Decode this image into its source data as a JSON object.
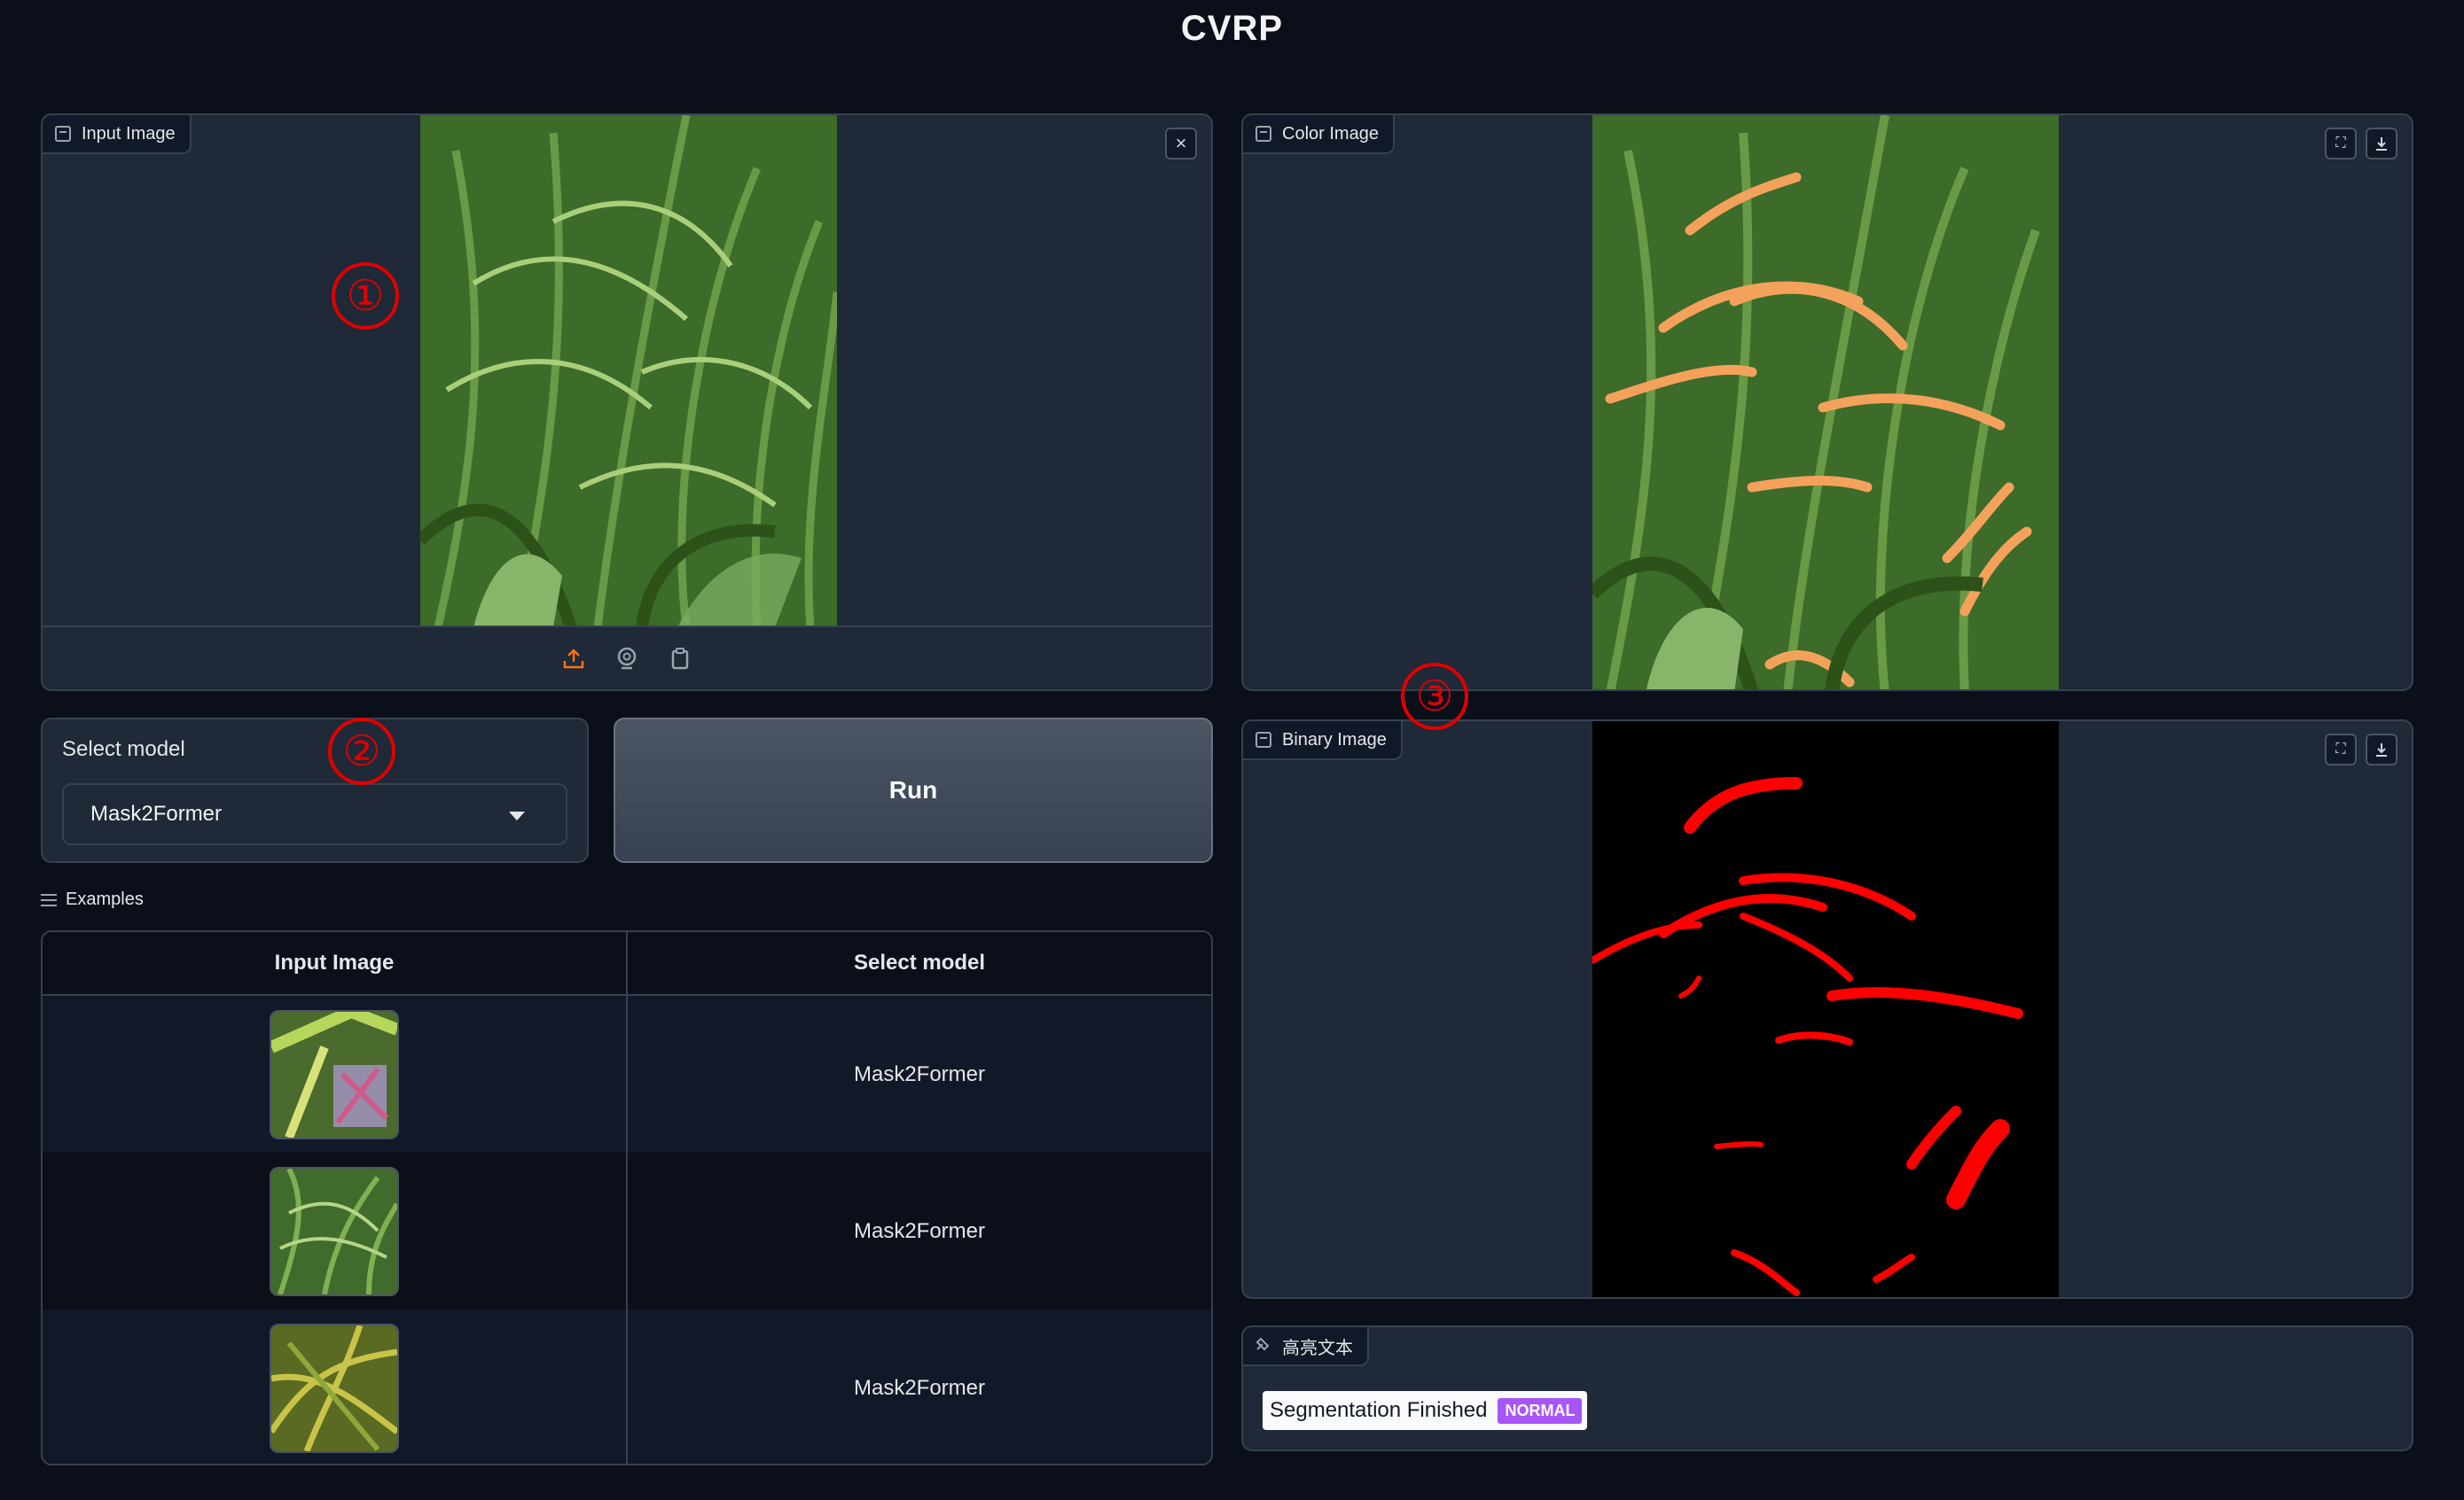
{
  "app": {
    "title": "CVRP"
  },
  "input_panel": {
    "label": "Input Image",
    "clear_icon": "close-icon",
    "tools": [
      "upload-icon",
      "webcam-icon",
      "clipboard-icon"
    ]
  },
  "color_panel": {
    "label": "Color Image",
    "buttons": [
      "fullscreen-icon",
      "download-icon"
    ]
  },
  "binary_panel": {
    "label": "Binary Image",
    "buttons": [
      "fullscreen-icon",
      "download-icon"
    ]
  },
  "model_select": {
    "label": "Select model",
    "value": "Mask2Former"
  },
  "run_button": {
    "label": "Run"
  },
  "annotations": [
    "①",
    "②",
    "③"
  ],
  "examples": {
    "heading": "Examples",
    "columns": [
      "Input Image",
      "Select model"
    ],
    "rows": [
      {
        "model": "Mask2Former"
      },
      {
        "model": "Mask2Former"
      },
      {
        "model": "Mask2Former"
      }
    ]
  },
  "highlight_panel": {
    "label": "高亮文本",
    "text": "Segmentation Finished",
    "badge": "NORMAL"
  },
  "colors": {
    "background": "#0b0f19",
    "panel": "#1f2937",
    "accent_orange": "#f97316",
    "badge_purple": "#a855f7",
    "mask_red": "#ff0000"
  }
}
